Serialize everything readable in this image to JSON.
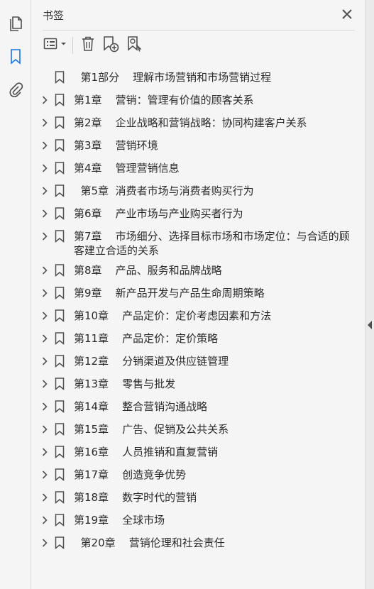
{
  "panel": {
    "title": "书签"
  },
  "rail": {
    "items": [
      {
        "name": "page-thumbnails",
        "icon": "pages-icon"
      },
      {
        "name": "bookmarks",
        "icon": "bookmark-icon",
        "active": true
      },
      {
        "name": "attachments",
        "icon": "paperclip-icon"
      }
    ]
  },
  "toolbar": {
    "buttons": [
      {
        "name": "options-menu",
        "icon": "list-options-icon"
      },
      {
        "name": "delete-bookmark",
        "icon": "trash-icon"
      },
      {
        "name": "new-bookmark",
        "icon": "add-bookmark-icon"
      },
      {
        "name": "find-current-bookmark",
        "icon": "bookmark-search-icon"
      }
    ]
  },
  "bookmarks": [
    {
      "label": "  第1部分    理解市场营销和市场营销过程",
      "expandable": false
    },
    {
      "label": "第1章    营销：管理有价值的顾客关系",
      "expandable": true
    },
    {
      "label": "第2章    企业战略和营销战略：协同构建客户关系",
      "expandable": true
    },
    {
      "label": "第3章    营销环境",
      "expandable": true
    },
    {
      "label": "第4章    管理营销信息",
      "expandable": true
    },
    {
      "label": "  第5章  消费者市场与消费者购买行为",
      "expandable": true
    },
    {
      "label": "第6章    产业市场与产业购买者行为",
      "expandable": true
    },
    {
      "label": "第7章    市场细分、选择目标市场和市场定位：与合适的顾客建立合适的关系",
      "expandable": true,
      "multiline": true
    },
    {
      "label": "第8章    产品、服务和品牌战略",
      "expandable": true
    },
    {
      "label": "第9章    新产品开发与产品生命周期策略",
      "expandable": true
    },
    {
      "label": "第10章    产品定价：定价考虑因素和方法",
      "expandable": true
    },
    {
      "label": "第11章    产品定价：定价策略",
      "expandable": true
    },
    {
      "label": "第12章    分销渠道及供应链管理",
      "expandable": true
    },
    {
      "label": "第13章    零售与批发",
      "expandable": true
    },
    {
      "label": "第14章    整合营销沟通战略",
      "expandable": true
    },
    {
      "label": "第15章    广告、促销及公共关系",
      "expandable": true
    },
    {
      "label": "第16章    人员推销和直复营销",
      "expandable": true
    },
    {
      "label": "第17章    创造竞争优势",
      "expandable": true
    },
    {
      "label": "第18章    数字时代的营销",
      "expandable": true
    },
    {
      "label": "第19章    全球市场",
      "expandable": true
    },
    {
      "label": "  第20章    营销伦理和社会责任",
      "expandable": true
    }
  ],
  "colors": {
    "accent": "#1473e6",
    "icon": "#505050",
    "background": "#f5f5f5"
  }
}
